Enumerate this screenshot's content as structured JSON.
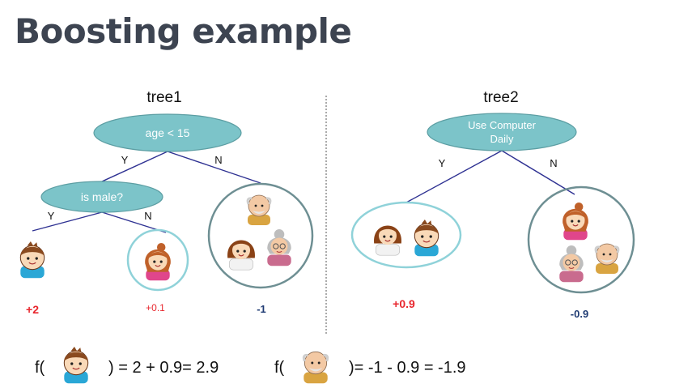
{
  "title": "Boosting example",
  "colors": {
    "title": "#3d4451",
    "node_fill": "#7cc4c9",
    "node_stroke": "#5c9ea3",
    "edge": "#2e3192",
    "group_circle": "#6e8f93",
    "highlight_circle": "#8fd2d9",
    "score_red": "#e8262d",
    "score_navy": "#1f3b73"
  },
  "tree1": {
    "label": "tree1",
    "root": "age < 15",
    "root_yes": "Y",
    "root_no": "N",
    "child": "is male?",
    "child_yes": "Y",
    "child_no": "N",
    "leaves": [
      {
        "icon": "boy",
        "score": "+2"
      },
      {
        "icon": "girl",
        "score": "+0.1"
      },
      {
        "icon": "family",
        "score": "-1"
      }
    ]
  },
  "tree2": {
    "label": "tree2",
    "root_line1": "Use Computer",
    "root_line2": "Daily",
    "root_yes": "Y",
    "root_no": "N",
    "leaves": [
      {
        "icon": "girl-and-boy",
        "score": "+0.9"
      },
      {
        "icon": "adults",
        "score": "-0.9"
      }
    ]
  },
  "formula": {
    "f1_open": "f(",
    "f1_result": ") = 2 + 0.9= 2.9",
    "f2_open": "f(",
    "f2_result": ")= -1 - 0.9 = -1.9"
  }
}
